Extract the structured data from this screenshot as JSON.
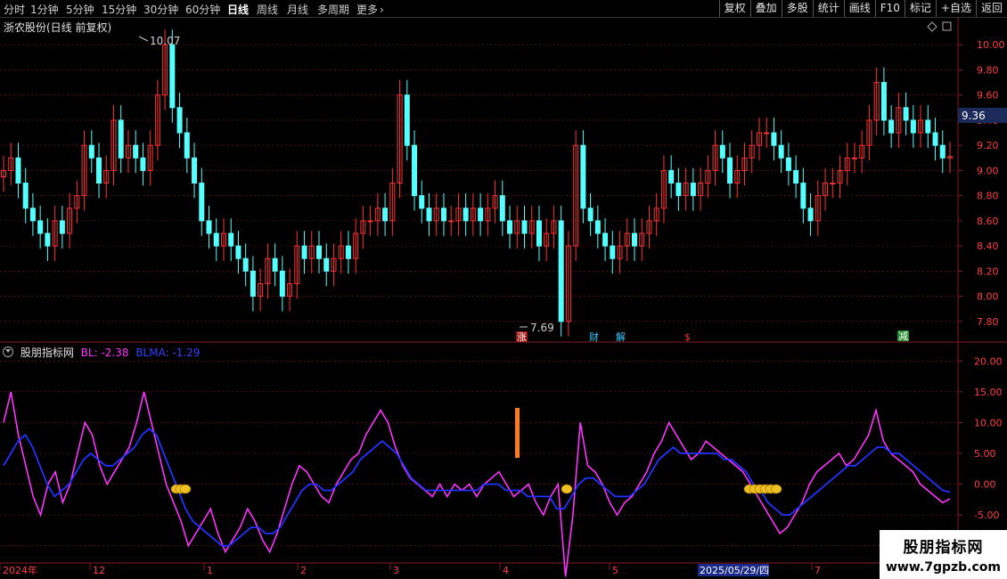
{
  "toolbar": {
    "periods": [
      "分时",
      "1分钟",
      "5分钟",
      "15分钟",
      "30分钟",
      "60分钟",
      "日线",
      "周线",
      "月线",
      "多周期",
      "更多"
    ],
    "active_period": "日线",
    "more_chevron": "›",
    "right_buttons": [
      "复权",
      "叠加",
      "多股",
      "统计",
      "画线",
      "F10",
      "标记",
      "+自选",
      "返回"
    ]
  },
  "main_title": "浙农股份(日线 前复权)",
  "price_label": "9.36",
  "high_label": "10.07",
  "low_label": "7.69",
  "event_markers": [
    {
      "text": "涨",
      "color": "#ffffff",
      "bg": "#a01010"
    },
    {
      "text": "财",
      "color": "#33ccff",
      "bg": ""
    },
    {
      "text": "解",
      "color": "#33ccff",
      "bg": ""
    },
    {
      "text": "$",
      "color": "#ff3030",
      "bg": ""
    },
    {
      "text": "减",
      "color": "#ffffff",
      "bg": "#209030"
    }
  ],
  "indicator": {
    "name": "股朋指标网",
    "bl_label": "BL: -2.38",
    "blma_label": "BLMA: -1.29",
    "bl_color": "#ff33ff",
    "blma_color": "#2233ff"
  },
  "date_axis": {
    "labels": [
      "2024年",
      "12",
      "1",
      "2",
      "3",
      "4",
      "5",
      "2025/05/29/四",
      "7"
    ],
    "highlight": "2025/05/29/四"
  },
  "watermark": {
    "line1": "股朋指标网",
    "line2": "www.7gpzb.com"
  },
  "colors": {
    "up": "#ff3232",
    "down": "#54ffff",
    "grid": "#8b1a1a",
    "axis_text": "#ff4040"
  },
  "chart_data": [
    {
      "type": "candlestick",
      "title": "浙农股份(日线 前复权)",
      "ylim": [
        7.65,
        10.2
      ],
      "yticks": [
        7.8,
        8.0,
        8.2,
        8.4,
        8.6,
        8.8,
        9.0,
        9.2,
        9.4,
        9.6,
        9.8,
        10.0
      ],
      "high": 10.07,
      "low": 7.69,
      "last": 9.36,
      "close": [
        9.0,
        9.1,
        8.9,
        8.7,
        8.6,
        8.5,
        8.4,
        8.6,
        8.5,
        8.7,
        8.8,
        9.2,
        9.1,
        8.9,
        9.0,
        9.4,
        9.1,
        9.2,
        9.1,
        9.0,
        9.2,
        9.6,
        10.0,
        9.5,
        9.3,
        9.1,
        8.9,
        8.6,
        8.5,
        8.4,
        8.5,
        8.4,
        8.3,
        8.2,
        8.0,
        8.1,
        8.3,
        8.2,
        8.0,
        8.1,
        8.4,
        8.3,
        8.4,
        8.3,
        8.2,
        8.3,
        8.4,
        8.3,
        8.5,
        8.6,
        8.6,
        8.7,
        8.6,
        8.9,
        9.6,
        9.2,
        8.8,
        8.7,
        8.6,
        8.7,
        8.6,
        8.6,
        8.7,
        8.6,
        8.7,
        8.6,
        8.7,
        8.8,
        8.6,
        8.5,
        8.6,
        8.5,
        8.6,
        8.4,
        8.5,
        8.6,
        7.8,
        8.4,
        9.2,
        8.7,
        8.6,
        8.5,
        8.4,
        8.3,
        8.4,
        8.5,
        8.4,
        8.5,
        8.6,
        8.7,
        9.0,
        8.9,
        8.8,
        8.9,
        8.8,
        8.9,
        9.0,
        9.2,
        9.1,
        8.9,
        9.0,
        9.1,
        9.2,
        9.3,
        9.3,
        9.2,
        9.1,
        9.0,
        8.9,
        8.7,
        8.6,
        8.8,
        8.9,
        8.9,
        9.0,
        9.1,
        9.1,
        9.2,
        9.4,
        9.7,
        9.4,
        9.3,
        9.5,
        9.4,
        9.3,
        9.4,
        9.3,
        9.2,
        9.1,
        9.11
      ],
      "note": "OHLC series approximated; full candles rendered from close values"
    },
    {
      "type": "line",
      "title": "股朋指标网",
      "ylim": [
        -12.5,
        22.5
      ],
      "yticks": [
        -10.0,
        -5.0,
        0.0,
        5.0,
        10.0,
        15.0,
        20.0
      ],
      "series": [
        {
          "name": "BL",
          "values": [
            10,
            15,
            8,
            3,
            -2,
            -5,
            0,
            2,
            -3,
            0,
            5,
            10,
            8,
            3,
            0,
            2,
            4,
            6,
            10,
            15,
            10,
            5,
            0,
            -3,
            -6,
            -10,
            -8,
            -6,
            -4,
            -8,
            -11,
            -9,
            -7,
            -4,
            -6,
            -9,
            -11,
            -8,
            -4,
            0,
            3,
            2,
            0,
            -2,
            -3,
            0,
            2,
            4,
            5,
            8,
            10,
            12,
            10,
            6,
            3,
            1,
            0,
            -1,
            -2,
            0,
            -2,
            0,
            -1,
            0,
            -2,
            0,
            1,
            2,
            0,
            -2,
            -1,
            0,
            -3,
            -5,
            -2,
            0,
            -15,
            -5,
            10,
            3,
            2,
            0,
            -3,
            -5,
            -3,
            -2,
            0,
            2,
            5,
            7,
            10,
            8,
            6,
            4,
            5,
            7,
            6,
            5,
            4,
            3,
            2,
            0,
            -2,
            -4,
            -6,
            -8,
            -7,
            -5,
            -3,
            0,
            2,
            3,
            4,
            5,
            3,
            4,
            6,
            8,
            12,
            7,
            5,
            4,
            3,
            2,
            0,
            -1,
            -2,
            -3,
            -2.38
          ]
        },
        {
          "name": "BLMA",
          "values": [
            3,
            5,
            7,
            8,
            6,
            3,
            0,
            -2,
            -1,
            0,
            2,
            4,
            5,
            4,
            3,
            3,
            4,
            5,
            6,
            8,
            9,
            8,
            5,
            2,
            -1,
            -4,
            -6,
            -7,
            -8,
            -9,
            -10,
            -10,
            -9,
            -8,
            -7,
            -7,
            -8,
            -8,
            -7,
            -5,
            -3,
            -1,
            0,
            0,
            -1,
            -1,
            0,
            1,
            2,
            4,
            5,
            6,
            7,
            6,
            5,
            3,
            1,
            0,
            -1,
            -1,
            -1,
            -1,
            -1,
            -1,
            -1,
            -1,
            0,
            0,
            0,
            -1,
            -1,
            -1,
            -2,
            -2,
            -2,
            -2,
            -4,
            -4,
            -2,
            0,
            1,
            1,
            0,
            -1,
            -2,
            -2,
            -2,
            -1,
            0,
            2,
            4,
            5,
            6,
            5,
            5,
            5,
            5,
            5,
            5,
            4,
            4,
            3,
            2,
            0,
            -1,
            -3,
            -4,
            -5,
            -5,
            -4,
            -3,
            -2,
            -1,
            0,
            1,
            2,
            3,
            3,
            4,
            5,
            6,
            6,
            5,
            5,
            4,
            3,
            2,
            1,
            0,
            -1,
            -1.29
          ]
        }
      ]
    }
  ]
}
